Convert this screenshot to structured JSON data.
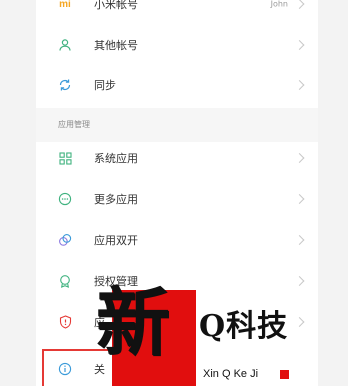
{
  "accounts": {
    "mi_account": {
      "icon": "mi-logo-icon",
      "label": "小米帐号",
      "value": "John"
    },
    "other_accounts": {
      "icon": "person-icon",
      "label": "其他帐号"
    },
    "sync": {
      "icon": "sync-icon",
      "label": "同步"
    }
  },
  "app_management": {
    "section_title": "应用管理",
    "system_apps": {
      "icon": "grid-icon",
      "label": "系统应用"
    },
    "more_apps": {
      "icon": "more-circle-icon",
      "label": "更多应用"
    },
    "dual_apps": {
      "icon": "dual-circles-icon",
      "label": "应用双开"
    },
    "permissions": {
      "icon": "shield-badge-icon",
      "label": "授权管理"
    },
    "security": {
      "icon": "shield-icon",
      "label": "应"
    }
  },
  "about": {
    "icon": "info-icon",
    "label": "关"
  },
  "colors": {
    "accent_green": "#3fb27f",
    "mi_orange": "#f5a623",
    "highlight_red": "#e53935",
    "watermark_red": "#e10e0e"
  },
  "watermark": {
    "char": "新",
    "title": "Q科技",
    "subtitle": "Xin Q Ke Ji"
  }
}
